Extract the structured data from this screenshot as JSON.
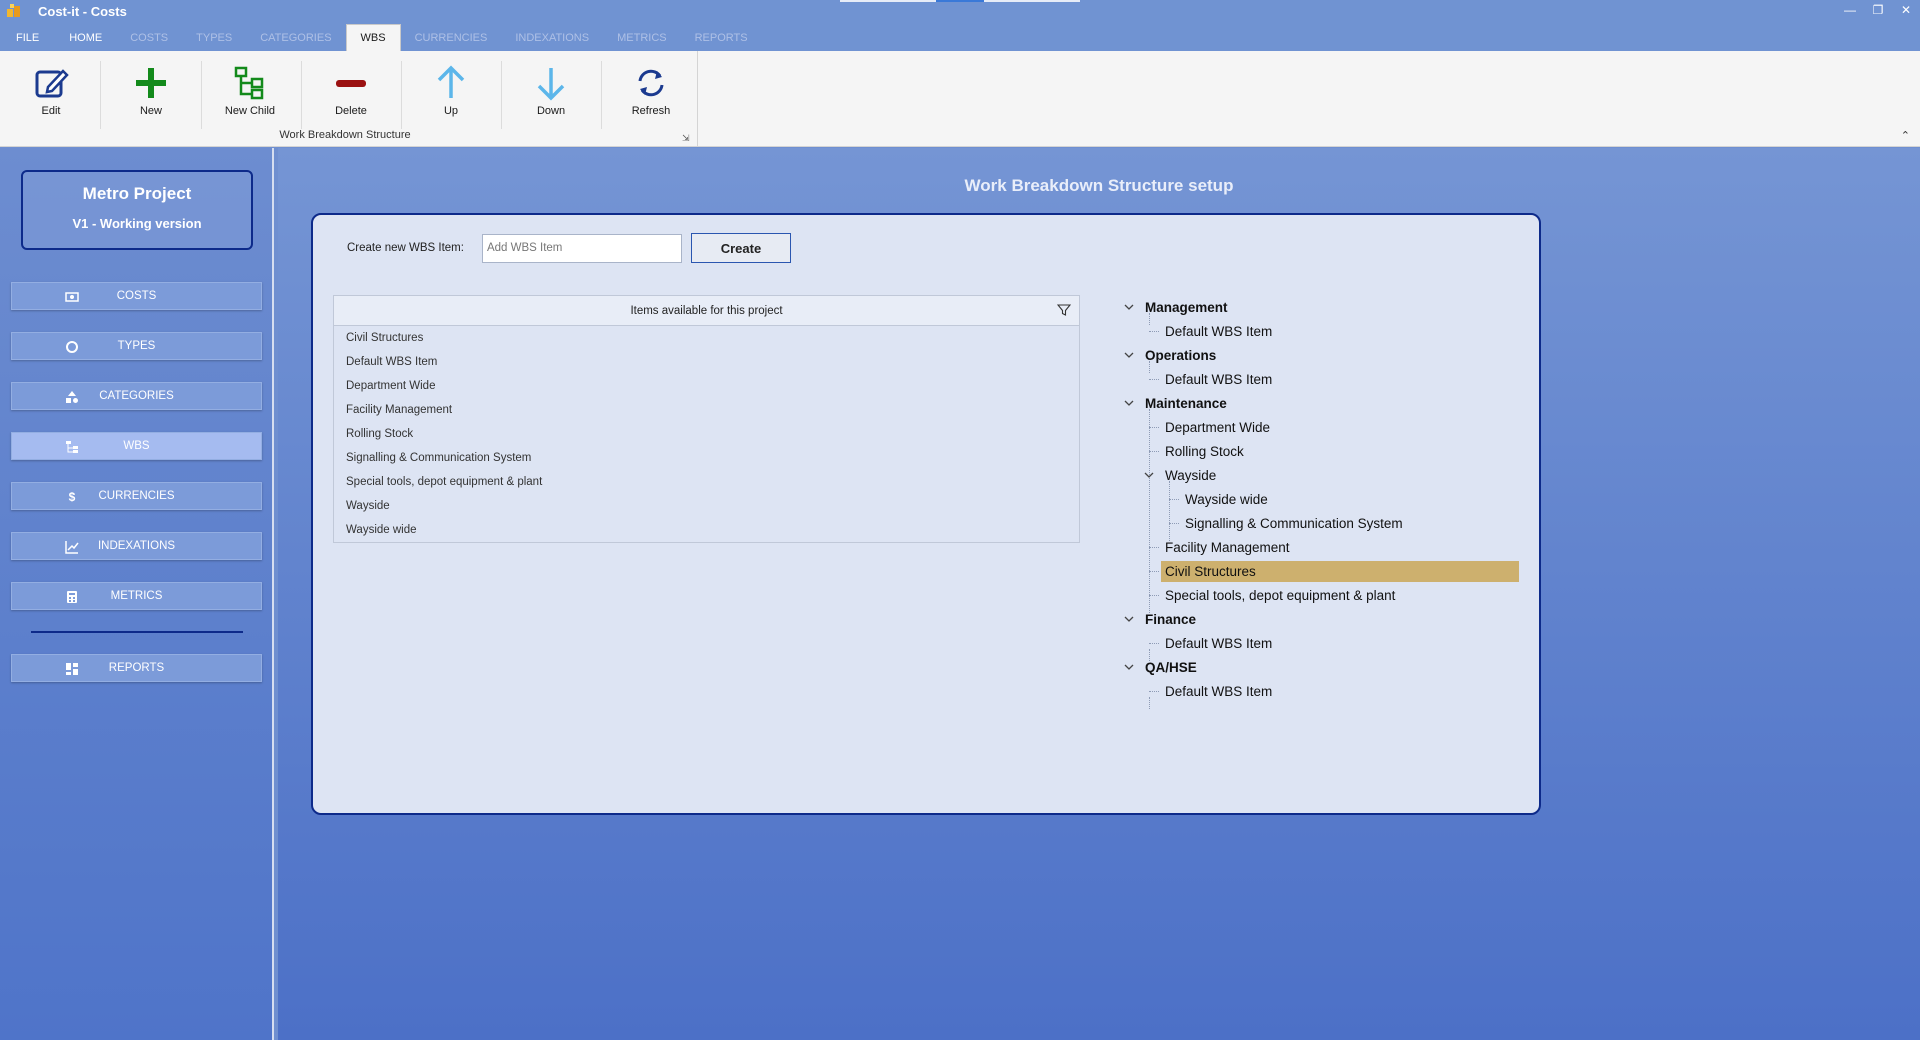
{
  "window": {
    "title": "Cost-it - Costs",
    "icon": "app-logo-icon"
  },
  "ribbon": {
    "tabs": [
      {
        "label": "FILE",
        "state": "enabled"
      },
      {
        "label": "HOME",
        "state": "enabled"
      },
      {
        "label": "COSTS",
        "state": "disabled"
      },
      {
        "label": "TYPES",
        "state": "disabled"
      },
      {
        "label": "CATEGORIES",
        "state": "disabled"
      },
      {
        "label": "WBS",
        "state": "active"
      },
      {
        "label": "CURRENCIES",
        "state": "disabled"
      },
      {
        "label": "INDEXATIONS",
        "state": "disabled"
      },
      {
        "label": "METRICS",
        "state": "disabled"
      },
      {
        "label": "REPORTS",
        "state": "disabled"
      }
    ],
    "buttons": {
      "edit": "Edit",
      "new": "New",
      "new_child": "New Child",
      "delete": "Delete",
      "up": "Up",
      "down": "Down",
      "refresh": "Refresh"
    },
    "group_label": "Work Breakdown Structure"
  },
  "sidebar": {
    "project_name": "Metro Project",
    "project_version": "V1 - Working version",
    "nav": [
      {
        "label": "COSTS",
        "icon": "money-icon"
      },
      {
        "label": "TYPES",
        "icon": "circle-icon"
      },
      {
        "label": "CATEGORIES",
        "icon": "shapes-icon"
      },
      {
        "label": "WBS",
        "icon": "hierarchy-icon",
        "active": true
      },
      {
        "label": "CURRENCIES",
        "icon": "dollar-icon"
      },
      {
        "label": "INDEXATIONS",
        "icon": "trend-icon"
      },
      {
        "label": "METRICS",
        "icon": "calculator-icon"
      },
      {
        "label": "REPORTS",
        "icon": "dashboard-icon"
      }
    ]
  },
  "main": {
    "title": "Work Breakdown Structure setup",
    "create": {
      "label": "Create new WBS Item:",
      "placeholder": "Add WBS Item",
      "button": "Create"
    },
    "items_header": "Items available for this project",
    "items": [
      "Civil Structures",
      "Default WBS Item",
      "Department Wide",
      "Facility Management",
      "Rolling Stock",
      "Signalling & Communication System",
      "Special tools, depot equipment & plant",
      "Wayside",
      "Wayside wide"
    ],
    "tree": [
      {
        "label": "Management",
        "level": 0,
        "expanded": true
      },
      {
        "label": "Default WBS Item",
        "level": 1
      },
      {
        "label": "Operations",
        "level": 0,
        "expanded": true
      },
      {
        "label": "Default WBS Item",
        "level": 1
      },
      {
        "label": "Maintenance",
        "level": 0,
        "expanded": true
      },
      {
        "label": "Department Wide",
        "level": 1
      },
      {
        "label": "Rolling Stock",
        "level": 1
      },
      {
        "label": "Wayside",
        "level": 1,
        "expanded": true
      },
      {
        "label": "Wayside wide",
        "level": 2
      },
      {
        "label": "Signalling & Communication System",
        "level": 2
      },
      {
        "label": "Facility Management",
        "level": 1
      },
      {
        "label": "Civil Structures",
        "level": 1,
        "selected": true
      },
      {
        "label": "Special tools, depot equipment & plant",
        "level": 1
      },
      {
        "label": "Finance",
        "level": 0,
        "expanded": true
      },
      {
        "label": "Default WBS Item",
        "level": 1
      },
      {
        "label": "QA/HSE",
        "level": 0,
        "expanded": true
      },
      {
        "label": "Default WBS Item",
        "level": 1
      }
    ]
  },
  "colors": {
    "accent": "#0d2a8a",
    "selection": "#cdb06e",
    "sidebar_button": "#7c9bd9",
    "sidebar_button_active": "#a5bbf0"
  }
}
